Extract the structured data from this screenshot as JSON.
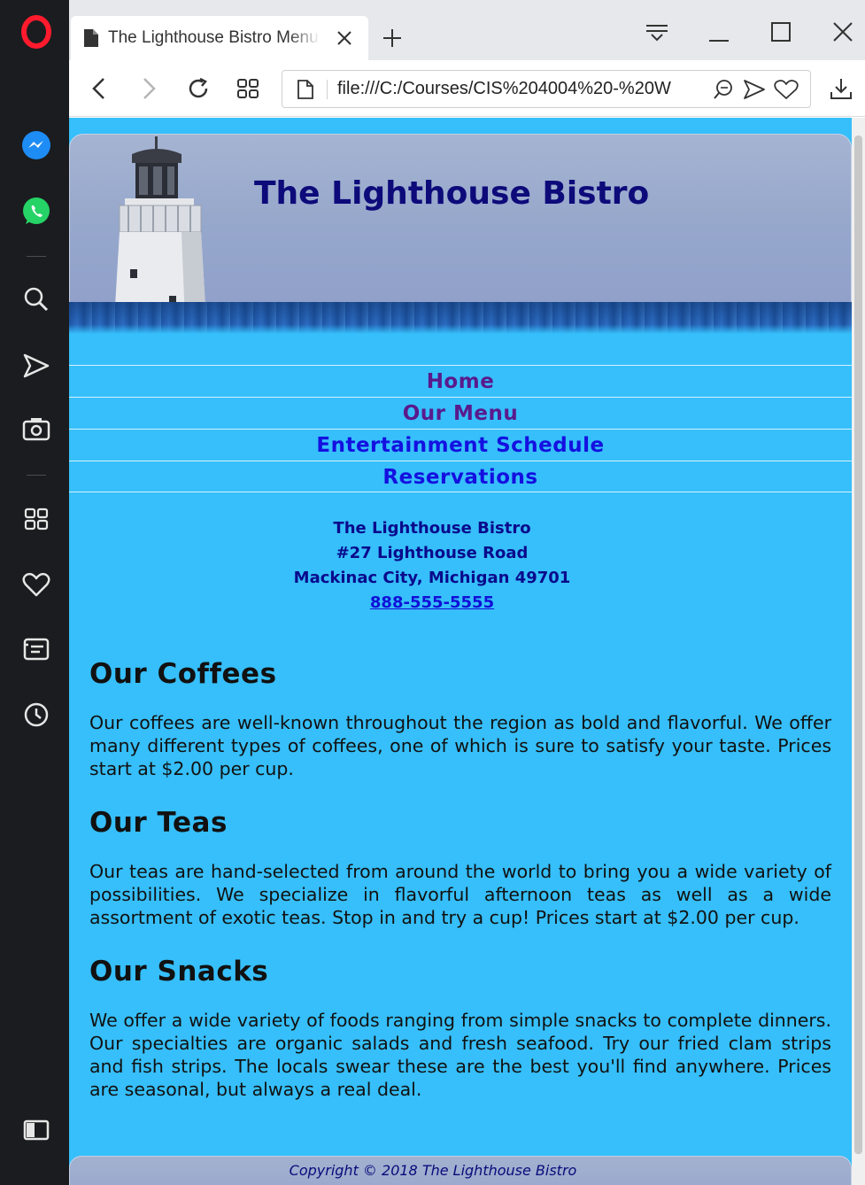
{
  "browser": {
    "tab_title": "The Lighthouse Bistro Menu",
    "url": "file:///C:/Courses/CIS%204004%20-%20W",
    "colors": {
      "sidebar_bg": "#1b1c1f",
      "tabbar_bg": "#e7e8eb",
      "opera_red": "#ff1b2d"
    },
    "sidebar_icons": [
      "opera-logo-icon",
      "messenger-icon",
      "whatsapp-icon",
      "search-icon",
      "send-icon",
      "camera-icon",
      "speed-dial-icon",
      "heart-icon",
      "news-icon",
      "history-icon",
      "sidebar-toggle-icon"
    ]
  },
  "site": {
    "title": "The Lighthouse Bistro",
    "colors": {
      "page_bg": "#36bffa",
      "title_color": "#0d0a7a",
      "visited_link": "#5a1a8c",
      "link": "#1410e0"
    },
    "nav": [
      {
        "label": "Home",
        "state": "visited"
      },
      {
        "label": "Our Menu",
        "state": "visited"
      },
      {
        "label": "Entertainment Schedule",
        "state": "unvisited"
      },
      {
        "label": "Reservations",
        "state": "unvisited"
      }
    ],
    "address": {
      "name": "The Lighthouse Bistro",
      "street": "#27 Lighthouse Road",
      "city": "Mackinac City, Michigan 49701",
      "phone": "888-555-5555"
    },
    "sections": [
      {
        "heading": "Our Coffees",
        "text": "Our coffees are well-known throughout the region as bold and flavorful. We offer many different types of coffees, one of which is sure to satisfy your taste. Prices start at $2.00 per cup."
      },
      {
        "heading": "Our Teas",
        "text": "Our teas are hand-selected from around the world to bring you a wide variety of possibilities. We specialize in flavorful afternoon teas as well as a wide assortment of exotic teas. Stop in and try a cup! Prices start at $2.00 per cup."
      },
      {
        "heading": "Our Snacks",
        "text": "We offer a wide variety of foods ranging from simple snacks to complete dinners. Our specialties are organic salads and fresh seafood. Try our fried clam strips and fish strips. The locals swear these are the best you'll find anywhere. Prices are seasonal, but always a real deal."
      }
    ],
    "footer": {
      "copyright": "Copyright © 2018 The Lighthouse Bistro"
    }
  }
}
